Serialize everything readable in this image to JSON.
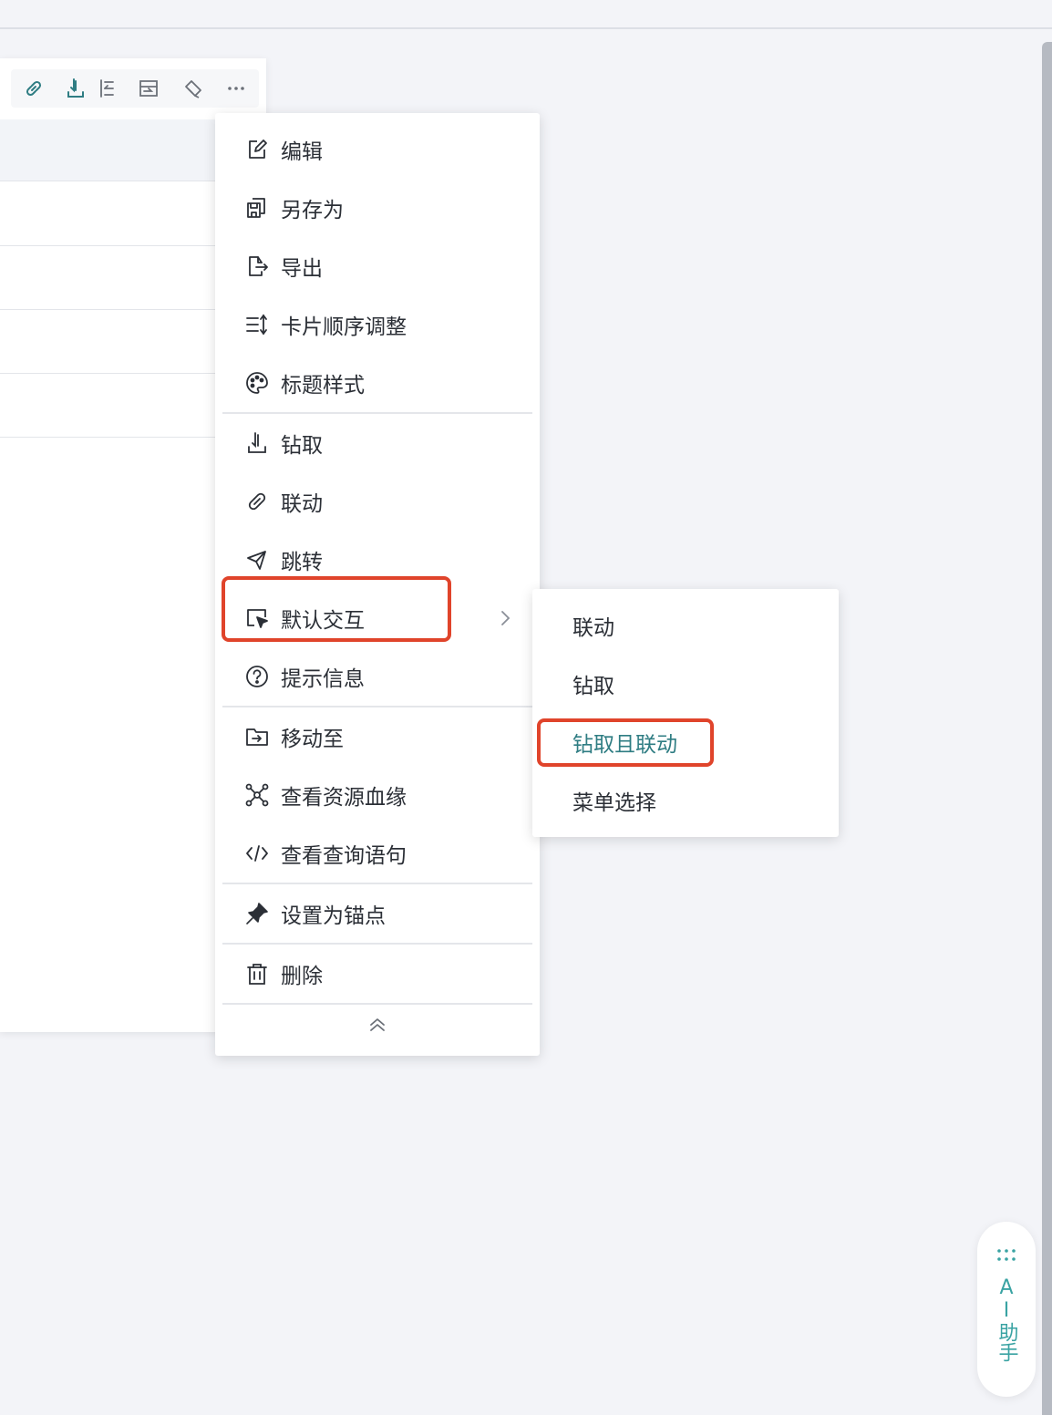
{
  "colors": {
    "accent": "#2f7d83",
    "highlight": "#e0442b",
    "ai_text": "#3aa3a3"
  },
  "toolbar": {
    "icons": [
      "link-icon",
      "drill-icon",
      "align-icon",
      "switch-icon",
      "brush-icon",
      "more-icon"
    ]
  },
  "menu": {
    "items": [
      {
        "label": "编辑",
        "icon": "edit-icon"
      },
      {
        "label": "另存为",
        "icon": "save-as-icon"
      },
      {
        "label": "导出",
        "icon": "export-icon"
      },
      {
        "label": "卡片顺序调整",
        "icon": "sort-icon"
      },
      {
        "label": "标题样式",
        "icon": "palette-icon"
      },
      {
        "label": "钻取",
        "icon": "drill-icon"
      },
      {
        "label": "联动",
        "icon": "link-icon"
      },
      {
        "label": "跳转",
        "icon": "send-icon"
      },
      {
        "label": "默认交互",
        "icon": "cursor-icon",
        "has_submenu": true
      },
      {
        "label": "提示信息",
        "icon": "help-icon"
      },
      {
        "label": "移动至",
        "icon": "move-folder-icon"
      },
      {
        "label": "查看资源血缘",
        "icon": "lineage-icon"
      },
      {
        "label": "查看查询语句",
        "icon": "code-icon"
      },
      {
        "label": "设置为锚点",
        "icon": "pin-icon"
      },
      {
        "label": "删除",
        "icon": "trash-icon"
      }
    ]
  },
  "submenu": {
    "items": [
      {
        "label": "联动"
      },
      {
        "label": "钻取"
      },
      {
        "label": "钻取且联动",
        "active": true
      },
      {
        "label": "菜单选择"
      }
    ]
  },
  "ai_assistant": {
    "label": "AI助手"
  }
}
